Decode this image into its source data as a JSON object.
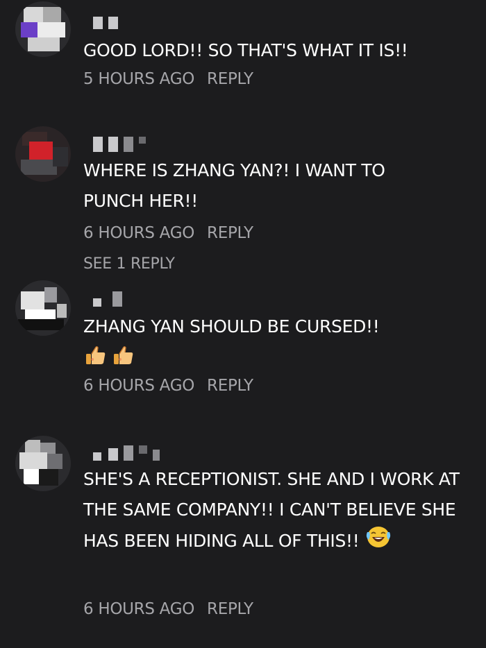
{
  "comments": [
    {
      "text": "GOOD LORD!! SO THAT'S WHAT IT IS!!",
      "time": "5 HOURS AGO",
      "reply_label": "REPLY"
    },
    {
      "text": "WHERE IS ZHANG YAN?! I WANT TO PUNCH HER!!",
      "time": "6 HOURS AGO",
      "reply_label": "REPLY",
      "see_replies": "SEE 1 REPLY"
    },
    {
      "text": "ZHANG YAN SHOULD BE CURSED!!",
      "emoji": [
        "thumbs-up-icon",
        "thumbs-up-icon"
      ],
      "time": "6 HOURS AGO",
      "reply_label": "REPLY"
    },
    {
      "text": "SHE'S A RECEPTIONIST. SHE AND I WORK AT THE SAME COMPANY!! I CAN'T BELIEVE SHE HAS BEEN HIDING ALL OF THIS!!",
      "emoji": [
        "crying-laughing-face-icon"
      ],
      "time": "6 HOURS AGO",
      "reply_label": "REPLY"
    }
  ],
  "colors": {
    "background": "#1c1c1e",
    "text": "#ffffff",
    "meta": "#a6a6aa"
  }
}
